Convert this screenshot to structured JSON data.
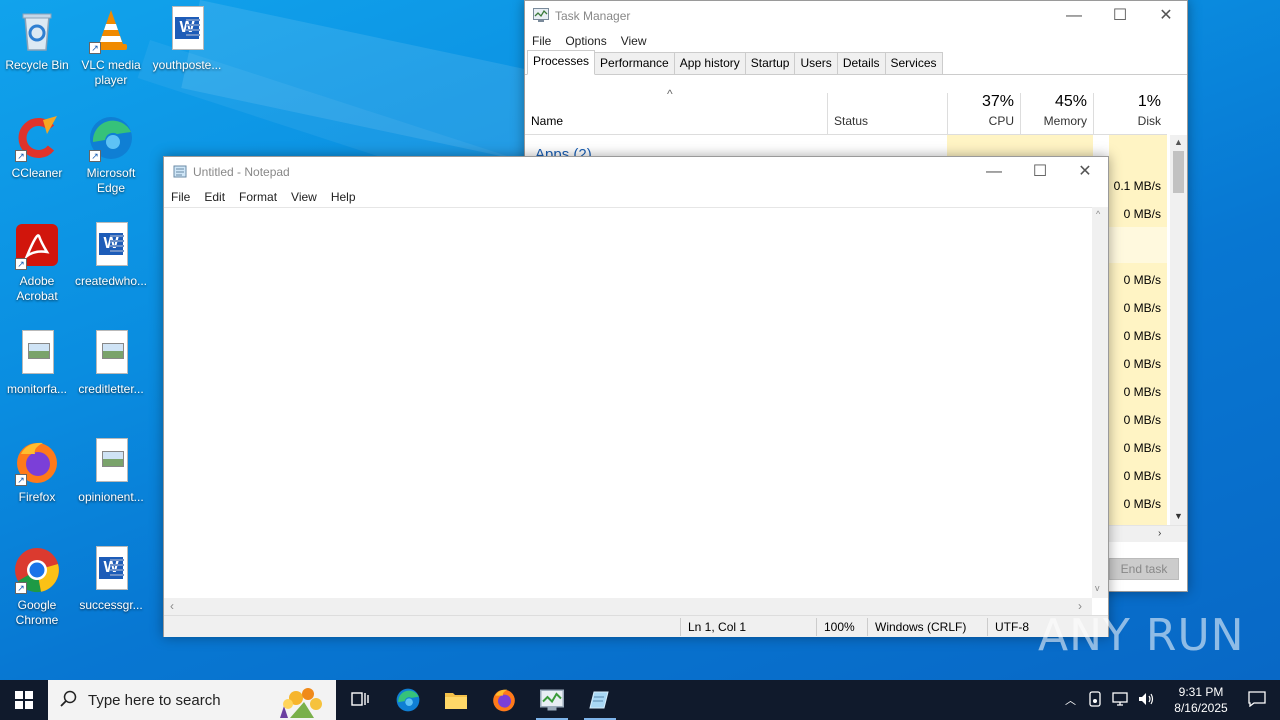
{
  "desktop": {
    "icons": [
      {
        "label": "Recycle Bin"
      },
      {
        "label": "VLC media player"
      },
      {
        "label": "youthposte..."
      },
      {
        "label": "CCleaner"
      },
      {
        "label": "Microsoft Edge"
      },
      {
        "label": "Adobe Acrobat"
      },
      {
        "label": "createdwho..."
      },
      {
        "label": "monitorfa..."
      },
      {
        "label": "creditletter..."
      },
      {
        "label": "Firefox"
      },
      {
        "label": "opinionent..."
      },
      {
        "label": "Google Chrome"
      },
      {
        "label": "successgr..."
      }
    ]
  },
  "taskmgr": {
    "title": "Task Manager",
    "menu": [
      "File",
      "Options",
      "View"
    ],
    "tabs": [
      "Processes",
      "Performance",
      "App history",
      "Startup",
      "Users",
      "Details",
      "Services"
    ],
    "active_tab": "Processes",
    "columns": {
      "name": "Name",
      "status": "Status",
      "cpu_pct": "37%",
      "cpu": "CPU",
      "mem_pct": "45%",
      "mem": "Memory",
      "disk_pct": "1%",
      "disk": "Disk"
    },
    "group": "Apps (2)",
    "disk_values": [
      "0.1 MB/s",
      "0 MB/s",
      "0 MB/s",
      "0 MB/s",
      "0 MB/s",
      "0 MB/s",
      "0 MB/s",
      "0 MB/s",
      "0 MB/s",
      "0 MB/s",
      "0 MB/s"
    ],
    "end_task": "End task"
  },
  "notepad": {
    "title": "Untitled - Notepad",
    "menu": [
      "File",
      "Edit",
      "Format",
      "View",
      "Help"
    ],
    "content": "",
    "status": {
      "position": "Ln 1, Col 1",
      "zoom": "100%",
      "line_ending": "Windows (CRLF)",
      "encoding": "UTF-8"
    }
  },
  "watermark": "ANY RUN",
  "taskbar": {
    "search_placeholder": "Type here to search",
    "time": "9:31 PM",
    "date": "8/16/2025"
  }
}
